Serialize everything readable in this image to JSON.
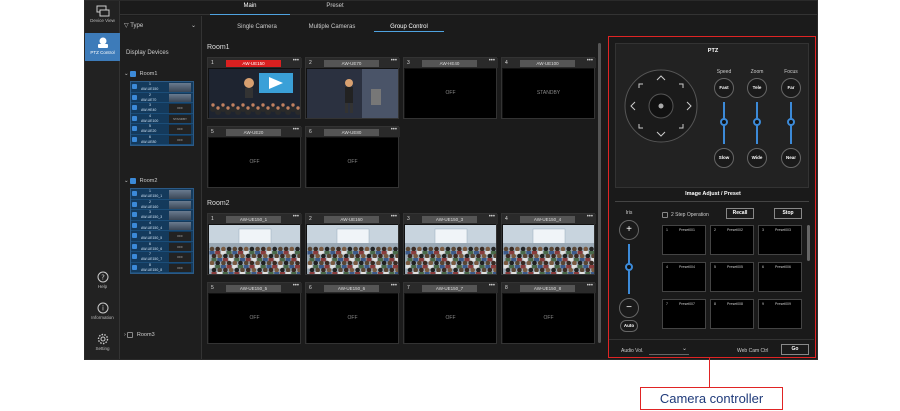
{
  "app": {
    "main_tabs": [
      "Main",
      "Preset"
    ],
    "sub_tabs": [
      "Single Camera",
      "Multiple Cameras",
      "Group Control"
    ],
    "active_sub_tab": "Group Control"
  },
  "rail": {
    "device_view": "Device View",
    "ptz_control": "PTZ Control",
    "help": "Help",
    "information": "Information",
    "setting": "Setting"
  },
  "device_panel": {
    "type_filter": "Type",
    "title": "Display Devices",
    "rooms": [
      {
        "name": "Room1",
        "devices": [
          {
            "num": "1",
            "name": "AW-UE150",
            "status": ""
          },
          {
            "num": "2",
            "name": "AW-UE70",
            "status": ""
          },
          {
            "num": "3",
            "name": "AW-HE40",
            "status": "OFF"
          },
          {
            "num": "4",
            "name": "AW-UE100",
            "status": "STANDBY"
          },
          {
            "num": "5",
            "name": "AW-UE20",
            "status": "OFF"
          },
          {
            "num": "6",
            "name": "AW-UE80",
            "status": "OFF"
          }
        ]
      },
      {
        "name": "Room2",
        "devices": [
          {
            "num": "1",
            "name": "AW-UE150_1",
            "status": ""
          },
          {
            "num": "2",
            "name": "AW-UE160",
            "status": ""
          },
          {
            "num": "3",
            "name": "AW-UE150_3",
            "status": ""
          },
          {
            "num": "4",
            "name": "AW-UE150_4",
            "status": ""
          },
          {
            "num": "5",
            "name": "AW-UE150_5",
            "status": "OFF"
          },
          {
            "num": "6",
            "name": "AW-UE150_6",
            "status": "OFF"
          },
          {
            "num": "7",
            "name": "AW-UE150_7",
            "status": "OFF"
          },
          {
            "num": "8",
            "name": "AW-UE150_8",
            "status": "OFF"
          }
        ]
      },
      {
        "name": "Room3",
        "devices": []
      }
    ]
  },
  "grid": {
    "room1": {
      "title": "Room1",
      "cams": [
        {
          "idx": "1",
          "name": "AW-UE150",
          "status": "",
          "live": true
        },
        {
          "idx": "2",
          "name": "AW-UE70",
          "status": "",
          "live": false
        },
        {
          "idx": "3",
          "name": "AW-HE40",
          "status": "OFF",
          "live": false
        },
        {
          "idx": "4",
          "name": "AW-UE100",
          "status": "STANDBY",
          "live": false
        },
        {
          "idx": "5",
          "name": "AW-UE20",
          "status": "OFF",
          "live": false
        },
        {
          "idx": "6",
          "name": "AW-UE80",
          "status": "OFF",
          "live": false
        }
      ]
    },
    "room2": {
      "title": "Room2",
      "cams": [
        {
          "idx": "1",
          "name": "AW-UE150_1",
          "status": "",
          "live": false
        },
        {
          "idx": "2",
          "name": "AW-UE160",
          "status": "",
          "live": false
        },
        {
          "idx": "3",
          "name": "AW-UE150_3",
          "status": "",
          "live": false
        },
        {
          "idx": "4",
          "name": "AW-UE150_4",
          "status": "",
          "live": false
        },
        {
          "idx": "5",
          "name": "AW-UE150_5",
          "status": "OFF",
          "live": false
        },
        {
          "idx": "6",
          "name": "AW-UE150_6",
          "status": "OFF",
          "live": false
        },
        {
          "idx": "7",
          "name": "AW-UE150_7",
          "status": "OFF",
          "live": false
        },
        {
          "idx": "8",
          "name": "AW-UE150_8",
          "status": "OFF",
          "live": false
        }
      ]
    }
  },
  "ptz": {
    "title": "PTZ",
    "speed_label": "Speed",
    "zoom_label": "Zoom",
    "focus_label": "Focus",
    "fast": "Fast",
    "slow": "Slow",
    "tele": "Tele",
    "wide": "Wide",
    "far": "Far",
    "near": "Near"
  },
  "image_adjust": {
    "title": "Image Adjust / Preset",
    "iris": "Iris",
    "auto": "Auto",
    "two_step": "2 Step Operation",
    "recall": "Recall",
    "stop": "Stop",
    "presets": [
      {
        "num": "1",
        "label": "Preset001"
      },
      {
        "num": "2",
        "label": "Preset002"
      },
      {
        "num": "3",
        "label": "Preset003"
      },
      {
        "num": "4",
        "label": "Preset004"
      },
      {
        "num": "5",
        "label": "Preset005"
      },
      {
        "num": "6",
        "label": "Preset006"
      },
      {
        "num": "7",
        "label": "Preset007"
      },
      {
        "num": "8",
        "label": "Preset008"
      },
      {
        "num": "9",
        "label": "Preset009"
      }
    ]
  },
  "footer": {
    "audio_vol": "Audio Vol.",
    "web_cam_ctrl": "Web Cam Ctrl",
    "go": "Go"
  },
  "callout": "Camera controller"
}
